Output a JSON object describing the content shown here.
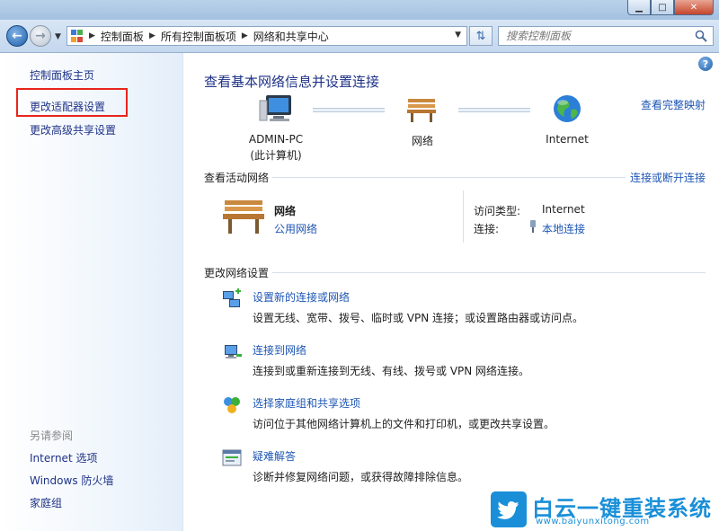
{
  "window": {
    "minimize_glyph": "▁",
    "maximize_glyph": "□",
    "close_glyph": "✕"
  },
  "navbar": {
    "breadcrumbs": [
      "控制面板",
      "所有控制面板项",
      "网络和共享中心"
    ],
    "search_placeholder": "搜索控制面板"
  },
  "sidebar": {
    "items": [
      "控制面板主页",
      "更改适配器设置",
      "更改高级共享设置"
    ],
    "see_also_title": "另请参阅",
    "see_also": [
      "Internet 选项",
      "Windows 防火墙",
      "家庭组"
    ]
  },
  "main": {
    "title": "查看基本网络信息并设置连接",
    "view_full_map": "查看完整映射",
    "map": {
      "computer_name": "ADMIN-PC",
      "computer_sub": "(此计算机)",
      "network": "网络",
      "internet": "Internet"
    },
    "active": {
      "title": "查看活动网络",
      "connect_link": "连接或断开连接",
      "network_name": "网络",
      "network_type": "公用网络",
      "access_label": "访问类型:",
      "access_value": "Internet",
      "conn_label": "连接:",
      "conn_value": "本地连接"
    },
    "change": {
      "title": "更改网络设置",
      "tasks": [
        {
          "title": "设置新的连接或网络",
          "desc": "设置无线、宽带、拨号、临时或 VPN 连接；或设置路由器或访问点。",
          "icon": "new-connection-icon"
        },
        {
          "title": "连接到网络",
          "desc": "连接到或重新连接到无线、有线、拨号或 VPN 网络连接。",
          "icon": "connect-network-icon"
        },
        {
          "title": "选择家庭组和共享选项",
          "desc": "访问位于其他网络计算机上的文件和打印机，或更改共享设置。",
          "icon": "homegroup-icon"
        },
        {
          "title": "疑难解答",
          "desc": "诊断并修复网络问题，或获得故障排除信息。",
          "icon": "troubleshoot-icon"
        }
      ]
    }
  },
  "watermark": {
    "brand": "白云一键重装系统",
    "url": "www.baiyunxitong.com",
    "color": "#1a8fd8"
  }
}
